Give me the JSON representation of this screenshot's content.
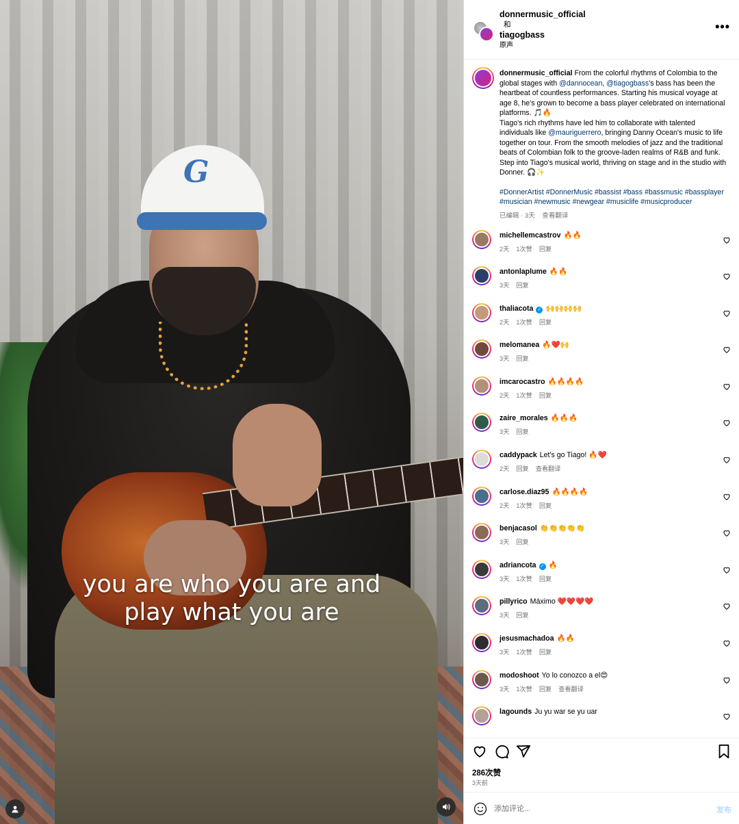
{
  "header": {
    "user1": "donnermusic_official",
    "and": "和",
    "user2": "tiagogbass",
    "audio": "原声",
    "more": "•••"
  },
  "video": {
    "caption_line1": "you are who you are and",
    "caption_line2": "play what you are"
  },
  "post_caption": {
    "username": "donnermusic_official",
    "p1_a": "From the colorful rhythms of Colombia to the global stages with ",
    "mention1": "@dannocean",
    "p1_b": ", ",
    "mention2": "@tiagogbass",
    "p1_c": "'s bass has been the heartbeat of countless performances. Starting his musical voyage at age 8, he's grown to become a bass player celebrated on international platforms. 🎵🔥",
    "p2_a": "Tiago's rich rhythms have led him to collaborate with talented individuals like ",
    "mention3": "@mauriguerrero",
    "p2_b": ", bringing Danny Ocean's music to life together on tour. From the smooth melodies of jazz and the traditional beats of Colombian folk to the groove-laden realms of R&B and funk. Step into Tiago's musical world, thriving on stage and in the studio with Donner. 🎧✨",
    "hashtags": "#DonnerArtist #DonnerMusic #bassist #bass #bassmusic #bassplayer #musician #newmusic #newgear #musiclife #musicproducer",
    "edited": "已编辑 · 3天",
    "translate": "查看翻译"
  },
  "comments": [
    {
      "user": "michellemcastrov",
      "verified": false,
      "text": "🔥🔥",
      "time": "2天",
      "likes": "1次赞",
      "reply": "回复",
      "translate": "",
      "avatar_color": "#9a7a64"
    },
    {
      "user": "antonlaplume",
      "verified": false,
      "text": "🔥🔥",
      "time": "3天",
      "likes": "",
      "reply": "回复",
      "translate": "",
      "avatar_color": "#2c3e6b"
    },
    {
      "user": "thaliacota",
      "verified": true,
      "text": "🙌🙌🙌🙌",
      "time": "2天",
      "likes": "1次赞",
      "reply": "回复",
      "translate": "",
      "avatar_color": "#c49a7a"
    },
    {
      "user": "melomanea",
      "verified": false,
      "text": "🔥❤️🙌",
      "time": "3天",
      "likes": "",
      "reply": "回复",
      "translate": "",
      "avatar_color": "#6e4a3a"
    },
    {
      "user": "imcarocastro",
      "verified": false,
      "text": "🔥🔥🔥🔥",
      "time": "2天",
      "likes": "1次赞",
      "reply": "回复",
      "translate": "",
      "avatar_color": "#b48f7a"
    },
    {
      "user": "zaire_morales",
      "verified": false,
      "text": "🔥🔥🔥",
      "time": "3天",
      "likes": "",
      "reply": "回复",
      "translate": "",
      "avatar_color": "#2e5b4a"
    },
    {
      "user": "caddypack",
      "verified": false,
      "text": "Let's go Tiago! 🔥❤️",
      "time": "2天",
      "likes": "",
      "reply": "回复",
      "translate": "查看翻译",
      "avatar_color": "#dcdcd6"
    },
    {
      "user": "carlose.diaz95",
      "verified": false,
      "text": "🔥🔥🔥🔥",
      "time": "2天",
      "likes": "1次赞",
      "reply": "回复",
      "translate": "",
      "avatar_color": "#4a6e8e"
    },
    {
      "user": "benjacasol",
      "verified": false,
      "text": "👏👏👏👏👏",
      "time": "3天",
      "likes": "",
      "reply": "回复",
      "translate": "",
      "avatar_color": "#8a6a58"
    },
    {
      "user": "adriancota",
      "verified": true,
      "text": "🔥",
      "time": "3天",
      "likes": "1次赞",
      "reply": "回复",
      "translate": "",
      "avatar_color": "#3a3a3a"
    },
    {
      "user": "pillyrico",
      "verified": false,
      "text": "Máximo ❤️❤️❤️❤️",
      "time": "3天",
      "likes": "",
      "reply": "回复",
      "translate": "",
      "avatar_color": "#5c6e7c"
    },
    {
      "user": "jesusmachadoa",
      "verified": false,
      "text": "🔥🔥",
      "time": "3天",
      "likes": "1次赞",
      "reply": "回复",
      "translate": "",
      "avatar_color": "#2b2b30"
    },
    {
      "user": "modoshoot",
      "verified": false,
      "text": "Yo lo conozco a el😍",
      "time": "3天",
      "likes": "1次赞",
      "reply": "回复",
      "translate": "查看翻译",
      "avatar_color": "#6a5a4e"
    },
    {
      "user": "lagounds",
      "verified": false,
      "text": "Ju yu war se yu uar",
      "time": "",
      "likes": "",
      "reply": "",
      "translate": "",
      "avatar_color": "#b3a096"
    }
  ],
  "actions": {
    "likes": "286次赞",
    "age": "3天前"
  },
  "add_comment": {
    "placeholder": "添加评论...",
    "post": "发布"
  },
  "colors": {
    "link": "#00376b",
    "meta_gray": "#737373",
    "border": "#dbdbdb",
    "verified": "#0095f6"
  },
  "icons": [
    "user-tag-icon",
    "volume-icon",
    "more-icon",
    "heart-icon",
    "comment-icon",
    "share-icon",
    "bookmark-icon",
    "emoji-icon"
  ]
}
